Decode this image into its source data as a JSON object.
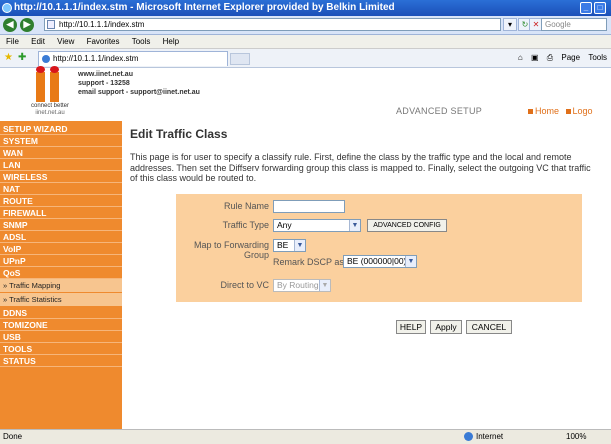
{
  "window": {
    "title": "http://10.1.1.1/index.stm - Microsoft Internet Explorer provided by Belkin Limited"
  },
  "address_bar": {
    "url": "http://10.1.1.1/index.stm",
    "search_placeholder": "Google"
  },
  "menu": [
    "File",
    "Edit",
    "View",
    "Favorites",
    "Tools",
    "Help"
  ],
  "tab": {
    "label": "http://10.1.1.1/index.stm"
  },
  "command_bar": {
    "page": "Page",
    "tools": "Tools"
  },
  "header": {
    "logo_tagline": "connect better",
    "logo_domain": "iinet.net.au",
    "contact": [
      "www.iinet.net.au",
      "support - 13258",
      "email support - support@iinet.net.au"
    ],
    "advanced_setup": "ADVANCED SETUP",
    "home": "Home",
    "logout": "Logo"
  },
  "sidebar": {
    "items": [
      {
        "label": "SETUP WIZARD"
      },
      {
        "label": "SYSTEM"
      },
      {
        "label": "WAN"
      },
      {
        "label": "LAN"
      },
      {
        "label": "WIRELESS"
      },
      {
        "label": "NAT"
      },
      {
        "label": "ROUTE"
      },
      {
        "label": "FIREWALL"
      },
      {
        "label": "SNMP"
      },
      {
        "label": "ADSL"
      },
      {
        "label": "VoIP"
      },
      {
        "label": "UPnP"
      },
      {
        "label": "QoS"
      },
      {
        "label": "» Traffic Mapping"
      },
      {
        "label": "» Traffic Statistics"
      },
      {
        "label": "DDNS"
      },
      {
        "label": "TOMIZONE"
      },
      {
        "label": "USB"
      },
      {
        "label": "TOOLS"
      },
      {
        "label": "STATUS"
      }
    ]
  },
  "main": {
    "title": "Edit Traffic Class",
    "description": "This page is for user to specify a classify rule. First, define the class by the traffic type and the local and remote addresses. Then set the Diffserv forwarding group this class is mapped to. Finally, select the outgoing VC that traffic of this class would be routed to.",
    "form": {
      "rule_name_label": "Rule Name",
      "rule_name_value": "",
      "traffic_type_label": "Traffic Type",
      "traffic_type_value": "Any",
      "advanced_config": "ADVANCED CONFIG",
      "map_forwarding_label": "Map to Forwarding Group",
      "forwarding_group_value": "BE",
      "remark_dscp_label": "Remark DSCP as",
      "remark_dscp_value": "BE (000000|00)",
      "direct_vc_label": "Direct to VC",
      "direct_vc_value": "By Routing"
    },
    "buttons": {
      "help": "HELP",
      "apply": "Apply",
      "cancel": "CANCEL"
    }
  },
  "status_bar": {
    "status": "Done",
    "zone": "Internet",
    "zoom": "100%"
  },
  "colors": {
    "sidebar": "#ef8a2e",
    "form_bg": "#fbd09e",
    "accent": "#e0701a"
  }
}
